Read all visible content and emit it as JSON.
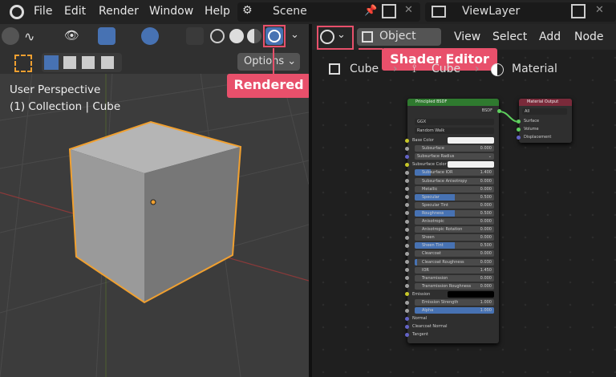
{
  "topbar": {
    "menus": [
      "File",
      "Edit",
      "Render",
      "Window",
      "Help"
    ],
    "scene": "Scene",
    "view_layer": "ViewLayer"
  },
  "viewport": {
    "options_label": "Options",
    "overlay_lines": [
      "User Perspective",
      "(1) Collection | Cube"
    ]
  },
  "node_editor": {
    "object_mode": "Object",
    "menus": [
      "View",
      "Select",
      "Add",
      "Node"
    ],
    "breadcrumb": [
      "Cube",
      "Cube",
      "Material"
    ]
  },
  "annotations": {
    "rendered": "Rendered",
    "shader_editor": "Shader Editor"
  },
  "principled": {
    "title": "Principled BSDF",
    "output": "BSDF",
    "distribution": "GGX",
    "subsurface_method": "Random Walk",
    "rows": [
      {
        "type": "color",
        "label": "Base Color",
        "color": "#f0f0f0",
        "sock": "#c7c729"
      },
      {
        "type": "value",
        "label": "Subsurface",
        "value": "0.000"
      },
      {
        "type": "menu",
        "label": "Subsurface Radius",
        "sock": "#6363c7"
      },
      {
        "type": "color",
        "label": "Subsurface Color",
        "color": "#f0f0f0",
        "sock": "#c7c729"
      },
      {
        "type": "value",
        "label": "Subsurface IOR",
        "value": "1.400",
        "fill": 0.2
      },
      {
        "type": "value",
        "label": "Subsurface Anisotropy",
        "value": "0.000"
      },
      {
        "type": "value",
        "label": "Metallic",
        "value": "0.000"
      },
      {
        "type": "value",
        "label": "Specular",
        "value": "0.500",
        "fill": 0.5
      },
      {
        "type": "value",
        "label": "Specular Tint",
        "value": "0.000"
      },
      {
        "type": "value",
        "label": "Roughness",
        "value": "0.500",
        "fill": 0.5
      },
      {
        "type": "value",
        "label": "Anisotropic",
        "value": "0.000"
      },
      {
        "type": "value",
        "label": "Anisotropic Rotation",
        "value": "0.000"
      },
      {
        "type": "value",
        "label": "Sheen",
        "value": "0.000"
      },
      {
        "type": "value",
        "label": "Sheen Tint",
        "value": "0.500",
        "fill": 0.5
      },
      {
        "type": "value",
        "label": "Clearcoat",
        "value": "0.000"
      },
      {
        "type": "value",
        "label": "Clearcoat Roughness",
        "value": "0.030",
        "fill": 0.03
      },
      {
        "type": "value",
        "label": "IOR",
        "value": "1.450"
      },
      {
        "type": "value",
        "label": "Transmission",
        "value": "0.000"
      },
      {
        "type": "value",
        "label": "Transmission Roughness",
        "value": "0.000"
      },
      {
        "type": "color",
        "label": "Emission",
        "color": "#000000",
        "sock": "#c7c729"
      },
      {
        "type": "value",
        "label": "Emission Strength",
        "value": "1.000"
      },
      {
        "type": "value",
        "label": "Alpha",
        "value": "1.000",
        "fill": 1
      },
      {
        "type": "plain",
        "label": "Normal",
        "sock": "#6363c7"
      },
      {
        "type": "plain",
        "label": "Clearcoat Normal",
        "sock": "#6363c7"
      },
      {
        "type": "plain",
        "label": "Tangent",
        "sock": "#6363c7"
      }
    ]
  },
  "material_output": {
    "title": "Material Output",
    "target": "All",
    "inputs": [
      "Surface",
      "Volume",
      "Displacement"
    ]
  }
}
